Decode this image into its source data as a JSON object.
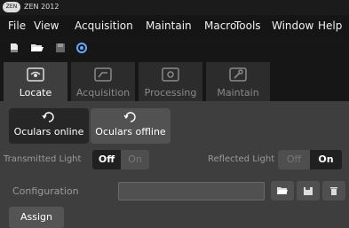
{
  "window": {
    "title": "ZEN 2012",
    "logo_text": "ZEN"
  },
  "menu": [
    "File",
    "View",
    "Acquisition",
    "Maintain",
    "Macro",
    "Tools",
    "Window",
    "Help"
  ],
  "toolbar": {
    "icons": [
      "new-document-icon",
      "open-folder-icon",
      "save-icon",
      "settings-icon"
    ]
  },
  "tabs": [
    {
      "label": "Locate",
      "icon": "eye-icon",
      "active": true
    },
    {
      "label": "Acquisition",
      "icon": "camera-icon",
      "active": false
    },
    {
      "label": "Processing",
      "icon": "gear-icon",
      "active": false
    },
    {
      "label": "Maintain",
      "icon": "wrench-icon",
      "active": false
    }
  ],
  "oculars": {
    "online_label": "Oculars online",
    "offline_label": "Oculars offline",
    "selected": "Oculars online"
  },
  "transmitted": {
    "label": "Transmitted Light",
    "off": "Off",
    "on": "On",
    "state": "Off"
  },
  "reflected": {
    "label": "Reflected Light",
    "off": "Off",
    "on": "On",
    "state": "On"
  },
  "configuration": {
    "label": "Configuration",
    "value": ""
  },
  "assign_label": "Assign"
}
